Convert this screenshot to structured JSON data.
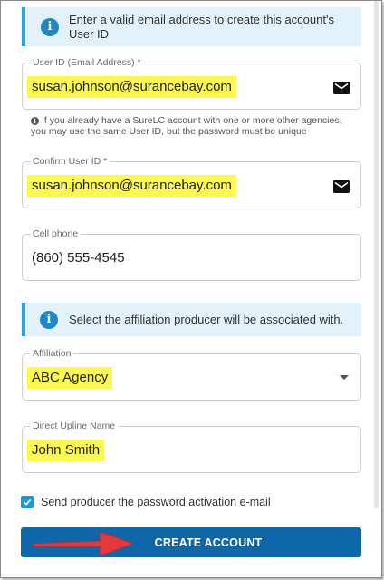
{
  "banner_top": {
    "text": "Enter a valid email address to create this account's User ID",
    "icon": "info-icon"
  },
  "user_id": {
    "label": "User ID (Email Address) *",
    "value": "susan.johnson@surancebay.com",
    "icon": "mail-icon"
  },
  "user_id_hint": "If you already have a SureLC account with one or more other agencies, you may use the same User ID, but the password must be unique",
  "confirm_user_id": {
    "label": "Confirm User ID *",
    "value": "susan.johnson@surancebay.com",
    "icon": "mail-icon"
  },
  "cell_phone": {
    "label": "Cell phone",
    "value": "(860) 555-4545"
  },
  "banner_affiliation": {
    "text": "Select the affiliation producer will be associated with.",
    "icon": "info-icon"
  },
  "affiliation": {
    "label": "Affiliation",
    "value": "ABC Agency",
    "icon": "chevron-down-icon"
  },
  "direct_upline": {
    "label": "Direct Upline Name",
    "value": "John Smith"
  },
  "send_activation": {
    "label": "Send producer the password activation e-mail",
    "checked": true
  },
  "create_button": {
    "label": "CREATE ACCOUNT"
  },
  "colors": {
    "highlight": "#fdf84e",
    "primary_button": "#0d67a8",
    "banner_bg": "#e3f1fb",
    "banner_border": "#29a3dd",
    "arrow": "#e8373a"
  }
}
